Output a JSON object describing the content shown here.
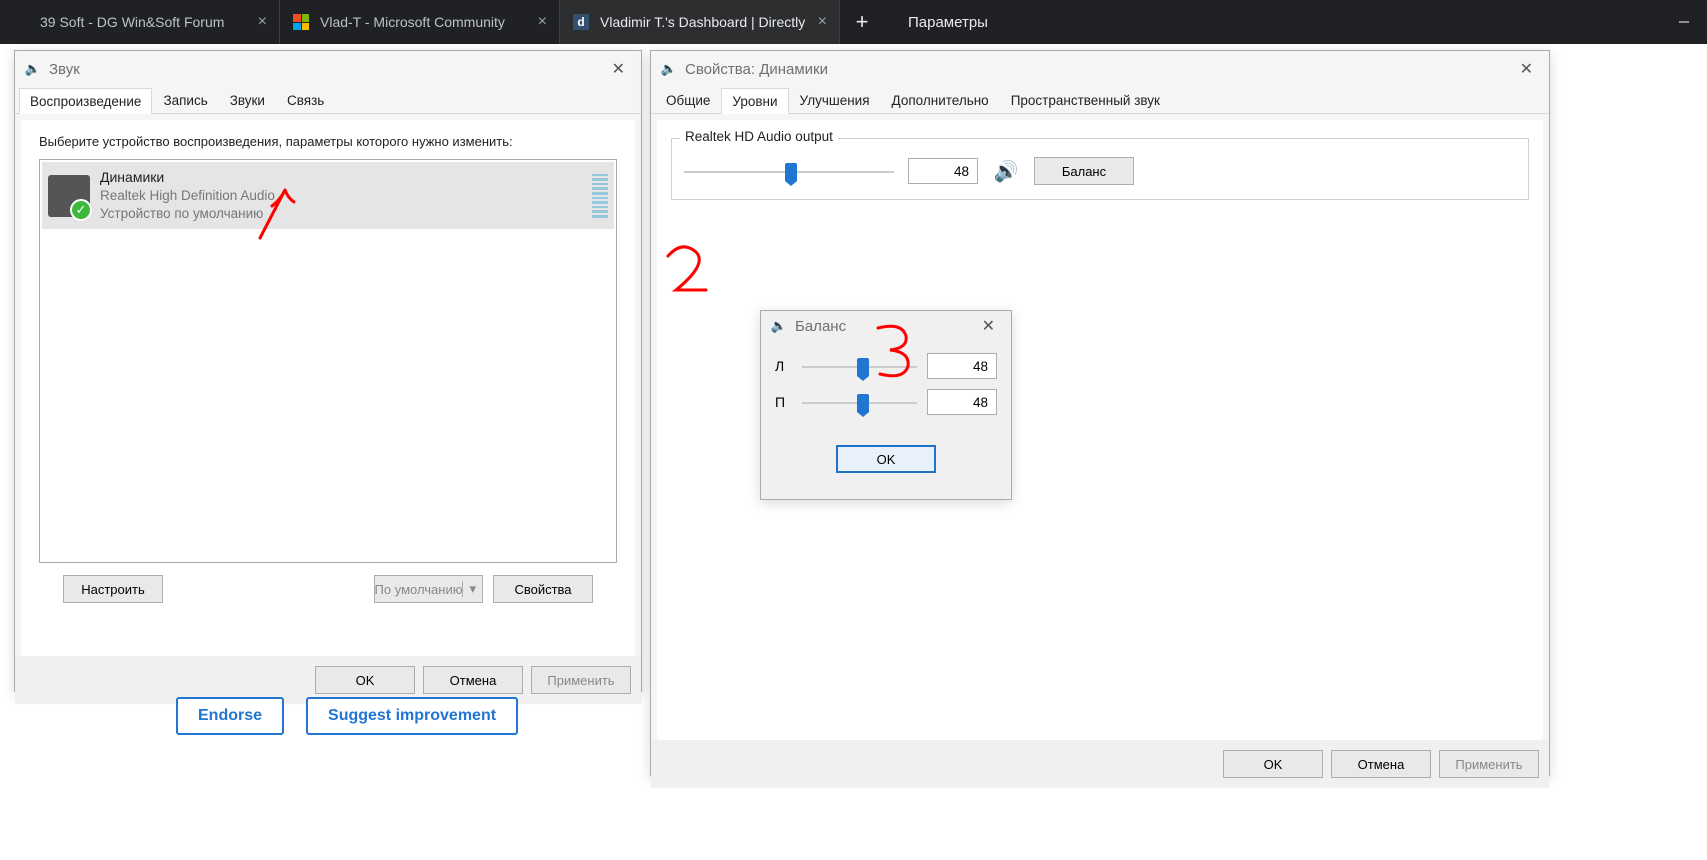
{
  "browser": {
    "tabs": [
      {
        "title": "39 Soft - DG Win&Soft Forum"
      },
      {
        "title": "Vlad-T - Microsoft Community"
      },
      {
        "title": "Vladimir T.'s Dashboard | Directly"
      }
    ],
    "app_title": "Параметры"
  },
  "sound_dialog": {
    "title": "Звук",
    "tabs": [
      "Воспроизведение",
      "Запись",
      "Звуки",
      "Связь"
    ],
    "instruction": "Выберите устройство воспроизведения, параметры которого нужно изменить:",
    "device": {
      "name": "Динамики",
      "sub1": "Realtek High Definition Audio",
      "sub2": "Устройство по умолчанию"
    },
    "buttons": {
      "configure": "Настроить",
      "set_default": "По умолчанию",
      "properties": "Свойства",
      "ok": "OK",
      "cancel": "Отмена",
      "apply": "Применить"
    }
  },
  "props_dialog": {
    "title": "Свойства: Динамики",
    "tabs": [
      "Общие",
      "Уровни",
      "Улучшения",
      "Дополнительно",
      "Пространственный звук"
    ],
    "output_label": "Realtek HD Audio output",
    "volume_value": "48",
    "balance_button": "Баланс",
    "buttons": {
      "ok": "OK",
      "cancel": "Отмена",
      "apply": "Применить"
    }
  },
  "balance_dialog": {
    "title": "Баланс",
    "left_label": "Л",
    "right_label": "П",
    "left_value": "48",
    "right_value": "48",
    "ok": "OK"
  },
  "page_buttons": {
    "endorse": "Endorse",
    "suggest": "Suggest improvement"
  },
  "annotations": {
    "one": "1",
    "two": "2",
    "three": "3"
  }
}
